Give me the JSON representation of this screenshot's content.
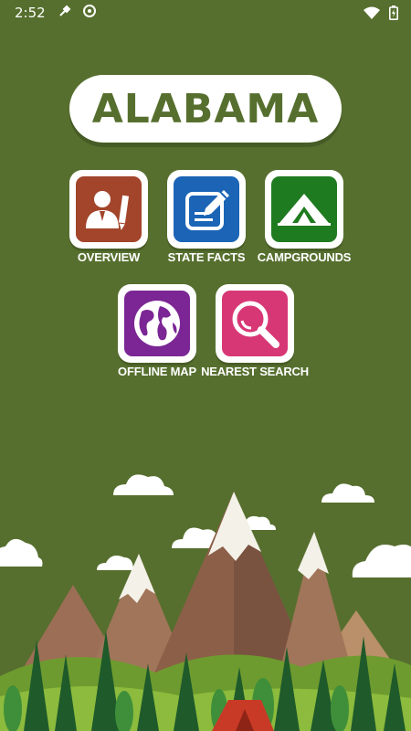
{
  "status_bar": {
    "time": "2:52",
    "icons": [
      "wrench-icon",
      "sync-icon",
      "wifi-icon",
      "battery-icon"
    ]
  },
  "header": {
    "title": "ALABAMA"
  },
  "menu": {
    "items": [
      {
        "label": "OVERVIEW",
        "icon": "person-document-icon",
        "color": "#a2452a"
      },
      {
        "label": "STATE FACTS",
        "icon": "pencil-note-icon",
        "color": "#1b64b6"
      },
      {
        "label": "CAMPGROUNDS",
        "icon": "tent-icon",
        "color": "#1f7b20"
      },
      {
        "label": "OFFLINE MAP",
        "icon": "globe-icon",
        "color": "#7b2694"
      },
      {
        "label": "NEAREST SEARCH",
        "icon": "magnifier-icon",
        "color": "#d83775"
      }
    ]
  },
  "colors": {
    "background": "#566f2e",
    "title_text": "#566f2e"
  }
}
